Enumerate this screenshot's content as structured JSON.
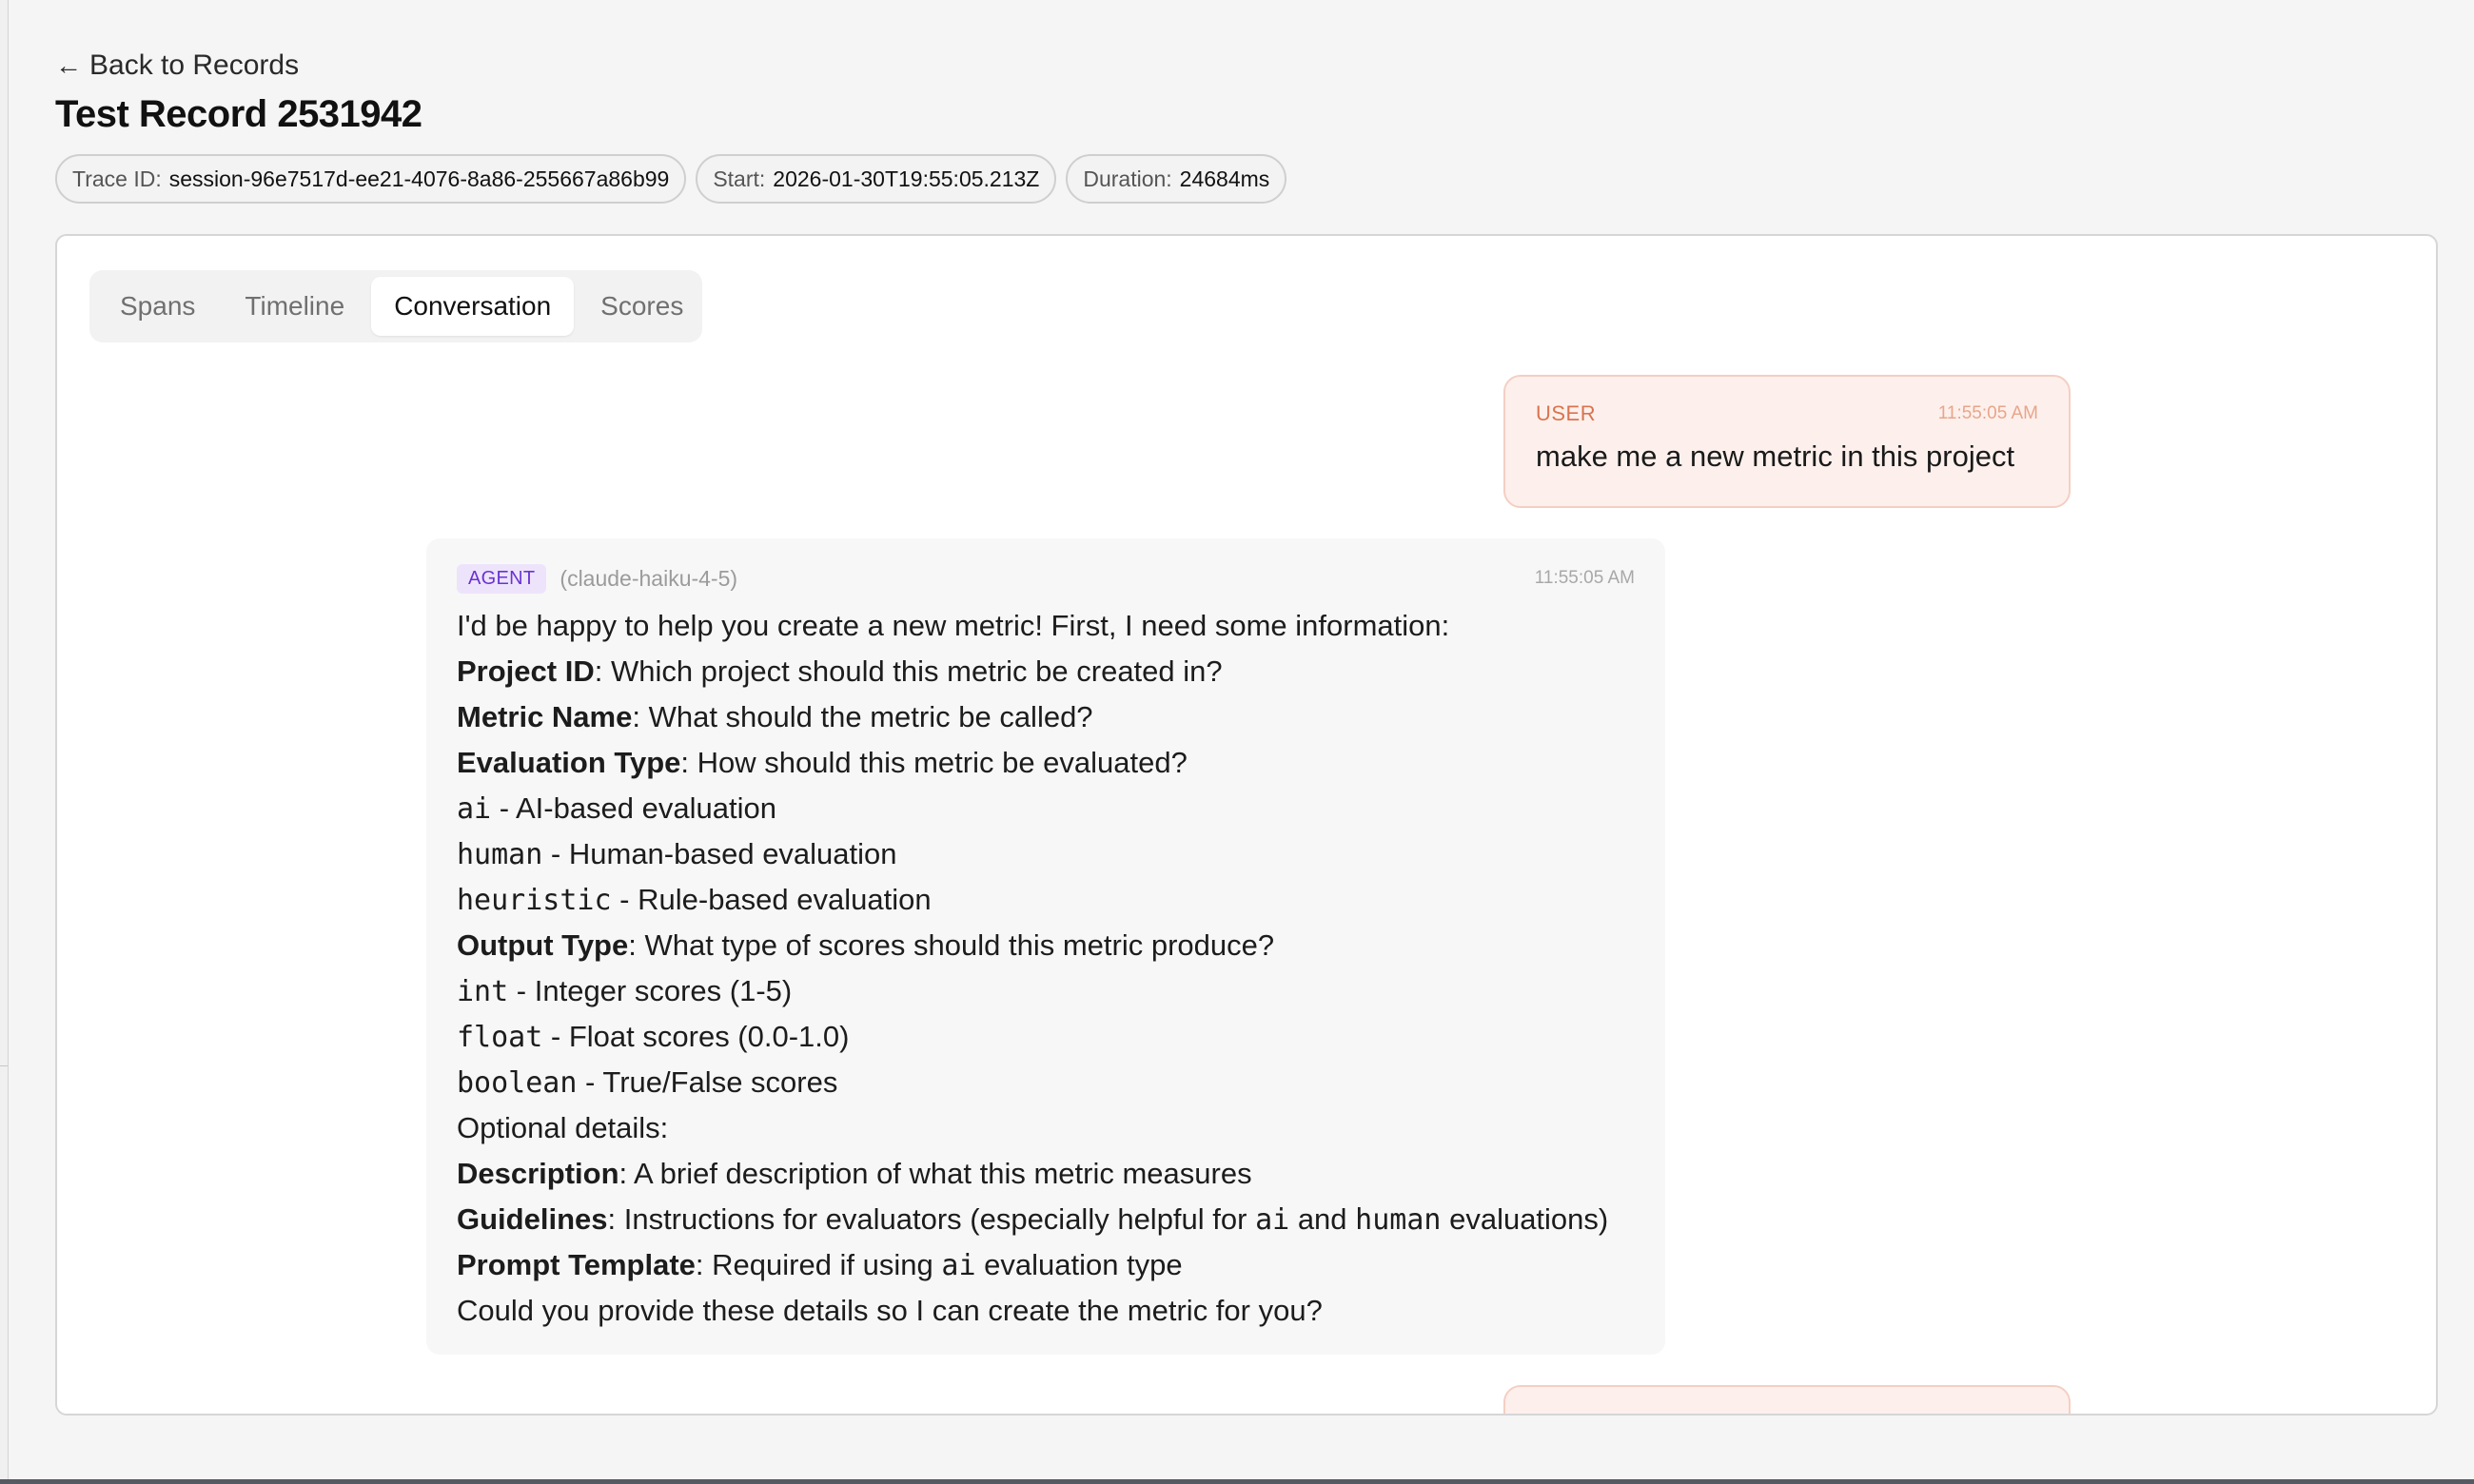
{
  "nav": {
    "back_arrow": "←",
    "back_label": "Back to Records"
  },
  "page": {
    "title": "Test Record 2531942"
  },
  "meta": {
    "trace_label": "Trace ID:",
    "trace_value": "session-96e7517d-ee21-4076-8a86-255667a86b99",
    "start_label": "Start:",
    "start_value": "2026-01-30T19:55:05.213Z",
    "duration_label": "Duration:",
    "duration_value": "24684ms"
  },
  "tabs": [
    {
      "label": "Spans"
    },
    {
      "label": "Timeline"
    },
    {
      "label": "Conversation",
      "active": true
    },
    {
      "label": "Scores"
    }
  ],
  "conversation": {
    "user_message": {
      "role": "USER",
      "time": "11:55:05 AM",
      "text": "make me a new metric in this project"
    },
    "agent_message": {
      "role": "AGENT",
      "model": "(claude-haiku-4-5)",
      "time": "11:55:05 AM",
      "lines": [
        {
          "plain": "I'd be happy to help you create a new metric! First, I need some information:"
        },
        {
          "bold": "Project ID",
          "rest": ": Which project should this metric be created in?"
        },
        {
          "bold": "Metric Name",
          "rest": ": What should the metric be called?"
        },
        {
          "bold": "Evaluation Type",
          "rest": ": How should this metric be evaluated?"
        },
        {
          "code": "ai",
          "rest": " - AI-based evaluation"
        },
        {
          "code": "human",
          "rest": " - Human-based evaluation"
        },
        {
          "code": "heuristic",
          "rest": " - Rule-based evaluation"
        },
        {
          "bold": "Output Type",
          "rest": ": What type of scores should this metric produce?"
        },
        {
          "code": "int",
          "rest": " - Integer scores (1-5)"
        },
        {
          "code": "float",
          "rest": " - Float scores (0.0-1.0)"
        },
        {
          "code": "boolean",
          "rest": " - True/False scores"
        },
        {
          "plain": "Optional details:"
        },
        {
          "bold": "Description",
          "rest": ": A brief description of what this metric measures"
        },
        {
          "bold": "Guidelines",
          "rest": ": Instructions for evaluators (especially helpful for ",
          "code2": "ai",
          "mid": " and ",
          "code3": "human",
          "end": " evaluations)"
        },
        {
          "bold": "Prompt Template",
          "rest": ": Required if using ",
          "code2": "ai",
          "end": " evaluation type"
        },
        {
          "plain": "Could you provide these details so I can create the metric for you?"
        }
      ]
    }
  },
  "colors": {
    "user_bg": "#fdf0ec",
    "user_border": "#f4cfc3",
    "agent_badge_bg": "#ede4fb",
    "agent_badge_text": "#6b33d1"
  },
  "icons": {
    "back": "arrow-left-icon"
  }
}
